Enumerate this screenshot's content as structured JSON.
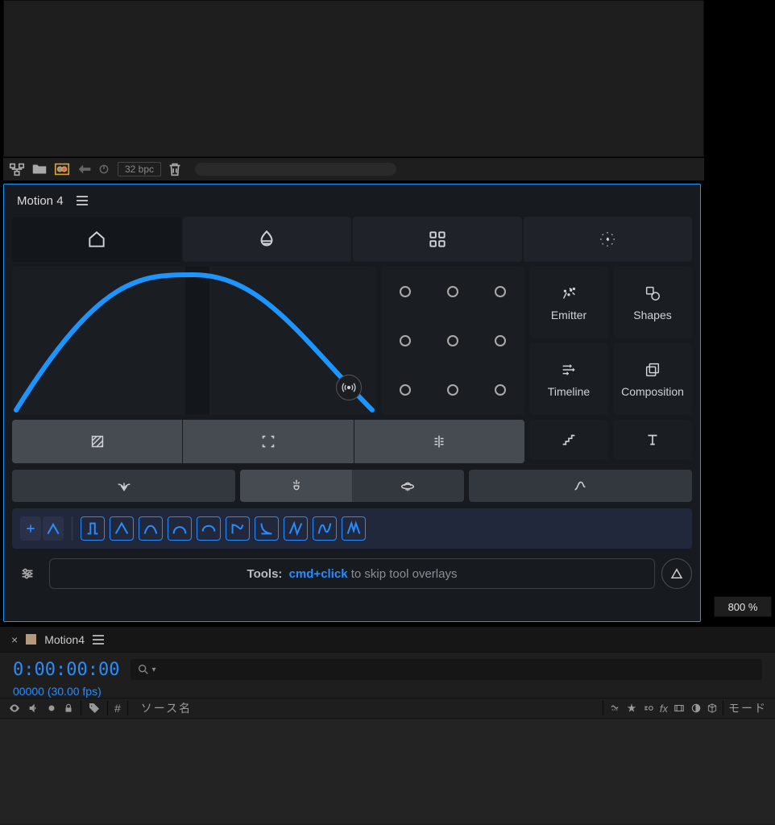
{
  "preview_toolbar": {
    "bit_depth": "32 bpc"
  },
  "motion_panel": {
    "title": "Motion 4",
    "tools": {
      "emitter": "Emitter",
      "shapes": "Shapes",
      "timeline": "Timeline",
      "composition": "Composition"
    },
    "hint": {
      "prefix": "Tools:",
      "shortcut": "cmd+click",
      "suffix": "to skip tool overlays"
    }
  },
  "zoom": "800 %",
  "timeline": {
    "tab_name": "Motion4",
    "timecode": "0:00:00:00",
    "frame_info": "00000 (30.00 fps)",
    "columns": {
      "hash": "#",
      "source_name": "ソース名",
      "mode": "モード"
    }
  }
}
